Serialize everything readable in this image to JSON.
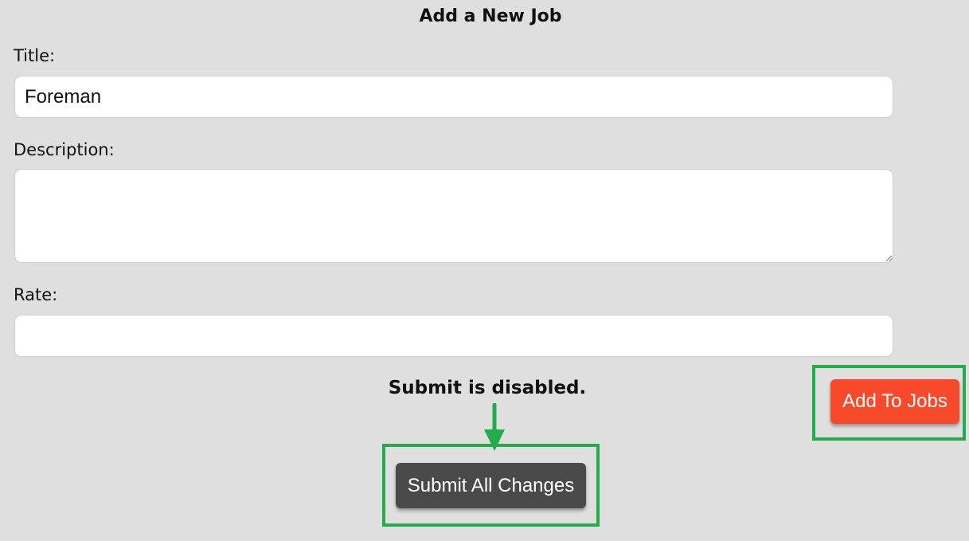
{
  "form": {
    "title": "Add a New Job",
    "fields": {
      "title": {
        "label": "Title:",
        "value": "Foreman"
      },
      "description": {
        "label": "Description:",
        "value": ""
      },
      "rate": {
        "label": "Rate:",
        "value": ""
      }
    }
  },
  "annotation": {
    "text": "Submit is disabled.",
    "highlight_color": "#22ac4a"
  },
  "buttons": {
    "add_to_jobs": {
      "label": "Add To Jobs",
      "color": "#f84a2b"
    },
    "submit_all": {
      "label": "Submit All Changes",
      "color": "#4a4a4a",
      "disabled": true
    }
  }
}
